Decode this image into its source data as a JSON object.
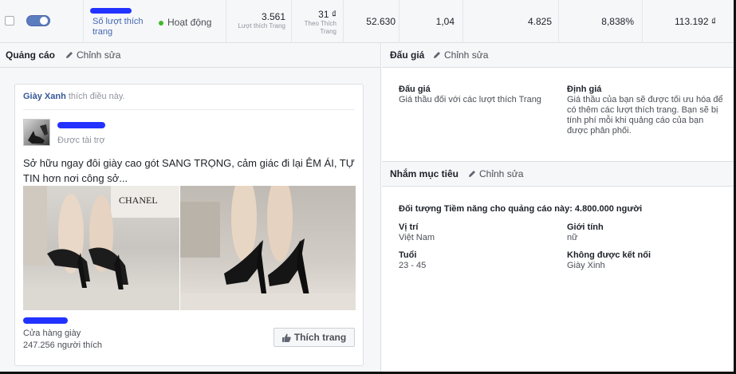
{
  "stats": {
    "name_label": "Số lượt thích trang",
    "status": "Hoạt động",
    "results_value": "3.561",
    "results_label": "Lượt thích Trang",
    "cost_value": "31 ₫",
    "cost_label": "Theo Thích Trang",
    "reach": "52.630",
    "frequency": "1,04",
    "clicks": "4.825",
    "ctr": "8,838%",
    "spend": "113.192 ₫"
  },
  "ad_panel": {
    "title": "Quảng cáo",
    "edit": "Chỉnh sửa",
    "liked_page": "Giày Xanh",
    "liked_suffix": "thích điều này.",
    "sponsored": "Được tài trợ",
    "text": "Sở hữu ngay đôi giày cao gót SANG TRỌNG, cảm giác đi lại ÊM ÁI, TỰ TIN hơn nơi công sở...",
    "image_brand": "CHANEL",
    "shop_category": "Cửa hàng giày",
    "shop_likes": "247.256 người thích",
    "like_button": "Thích trang"
  },
  "bid_panel": {
    "title": "Đấu giá",
    "edit": "Chỉnh sửa",
    "bid_label": "Đấu giá",
    "bid_value": "Giá thầu đối với các lượt thích Trang",
    "pricing_label": "Định giá",
    "pricing_value": "Giá thầu của bạn sẽ được tối ưu hóa để có thêm các lượt thích trang. Bạn sẽ bị tính phí mỗi khi quảng cáo của bạn được phân phối."
  },
  "targeting_panel": {
    "title": "Nhắm mục tiêu",
    "edit": "Chỉnh sửa",
    "audience": "Đối tượng Tiềm năng cho quảng cáo này: 4.800.000 người",
    "location_label": "Vị trí",
    "location_value": "Việt Nam",
    "gender_label": "Giới tính",
    "gender_value": "nữ",
    "age_label": "Tuổi",
    "age_value": "23 - 45",
    "exclusion_label": "Không được kết nối",
    "exclusion_value": "Giày Xinh"
  },
  "colors": {
    "link": "#4267b2",
    "status_active": "#42b72a",
    "toggle_on": "#5b7dbf",
    "redaction": "#2232ff"
  }
}
